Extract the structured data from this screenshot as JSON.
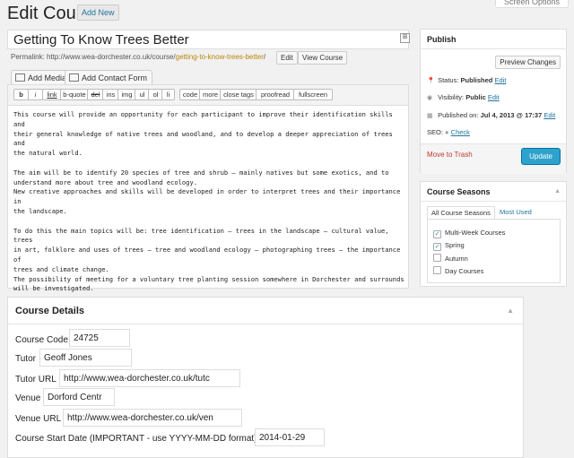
{
  "header": {
    "title": "Edit Course",
    "add_new": "Add New",
    "screen_options": "Screen Options"
  },
  "post": {
    "title": "Getting To Know Trees Better",
    "permalink_label": "Permalink:",
    "permalink_base": "http://www.wea-dorchester.co.uk/course/",
    "permalink_slug": "getting-to-know-trees-better",
    "permalink_tail": "/",
    "edit_label": "Edit",
    "view_label": "View Course"
  },
  "media": {
    "add_media": "Add Media",
    "add_contact": "Add Contact Form"
  },
  "quicktags": [
    "b",
    "i",
    "link",
    "b-quote",
    "del",
    "ins",
    "img",
    "ul",
    "ol",
    "li",
    "code",
    "more",
    "close tags",
    "proofread",
    "fullscreen"
  ],
  "editor": {
    "content": "This course will provide an opportunity for each participant to improve their identification skills and\ntheir general knowledge of native trees and woodland, and to develop a deeper appreciation of trees and\nthe natural world.\n\nThe aim will be to identify 20 species of tree and shrub – mainly natives but some exotics, and to\nunderstand more about tree and woodland ecology.\nNew creative approaches and skills will be developed in order to interpret trees and their importance in\nthe landscape.\n\nTo do this the main topics will be: tree identification – trees in the landscape – cultural value, trees\nin art, folklore and uses of trees – tree and woodland ecology – photographing trees – the importance of\ntrees and climate change.\nThe possibility of meeting for a voluntary tree planting session somewhere in Dorchester and surrounds\nwill be investigated.\n\nNo pre-course reading/preparation is required but a tree identification book would be useful.\nSome field work will be undertaken."
  },
  "publish": {
    "title": "Publish",
    "preview": "Preview Changes",
    "status_label": "Status:",
    "status_value": "Published",
    "visibility_label": "Visibility:",
    "visibility_value": "Public",
    "published_label": "Published on:",
    "published_value": "Jul 4, 2013 @ 17:37",
    "seo_label": "SEO:",
    "seo_link": "Check",
    "edit_link": "Edit",
    "trash": "Move to Trash",
    "update": "Update"
  },
  "seasons": {
    "title": "Course Seasons",
    "tab_all": "All Course Seasons",
    "tab_most": "Most Used",
    "items": [
      {
        "label": "Multi-Week Courses",
        "checked": true
      },
      {
        "label": "Spring",
        "checked": true
      },
      {
        "label": "Autumn",
        "checked": false
      },
      {
        "label": "Day Courses",
        "checked": false
      }
    ]
  },
  "details": {
    "title": "Course Details",
    "fields": [
      {
        "label": "Course Code",
        "value": "24725"
      },
      {
        "label": "Tutor",
        "value": "Geoff Jones"
      },
      {
        "label": "Tutor URL",
        "value": "http://www.wea-dorchester.co.uk/tutc"
      },
      {
        "label": "Venue",
        "value": "Dorford Centr"
      },
      {
        "label": "Venue URL",
        "value": "http://www.wea-dorchester.co.uk/ven"
      },
      {
        "label": "Course Start Date (IMPORTANT - use YYYY-MM-DD format)",
        "value": "2014-01-29"
      }
    ]
  },
  "colors": {
    "link": "#21759b",
    "update": "#2ea2cc",
    "trash": "#c0392b",
    "slug": "#b8860b"
  }
}
